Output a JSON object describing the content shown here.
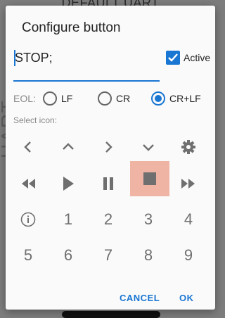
{
  "backdrop": {
    "title": "DEFAULT UART",
    "vertical_text": "UART"
  },
  "dialog": {
    "title": "Configure button",
    "command_value": "STOP;",
    "active_label": "Active",
    "active_checked": true
  },
  "eol": {
    "label": "EOL:",
    "options": [
      "LF",
      "CR",
      "CR+LF"
    ],
    "selected": "CR+LF"
  },
  "icons": {
    "label": "Select icon:",
    "selected": "stop-icon",
    "numbers": [
      "1",
      "2",
      "3",
      "4",
      "5",
      "6",
      "7",
      "8",
      "9"
    ]
  },
  "actions": {
    "cancel": "CANCEL",
    "ok": "OK"
  },
  "colors": {
    "accent": "#1976d2",
    "selected_icon_bg": "#f0b4a4",
    "icon": "#6f6f6f"
  }
}
